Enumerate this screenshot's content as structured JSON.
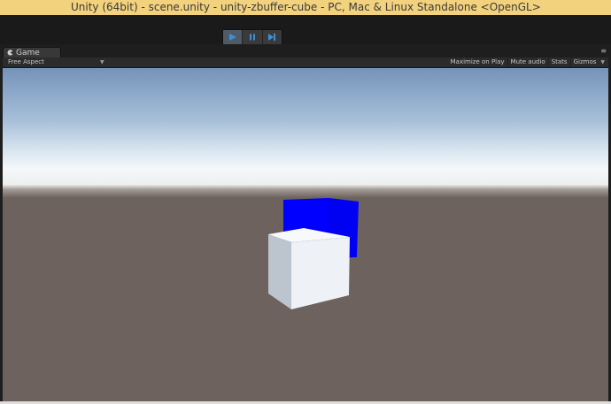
{
  "window": {
    "title": "Unity (64bit) - scene.unity - unity-zbuffer-cube - PC, Mac & Linux Standalone <OpenGL>"
  },
  "play_controls": {
    "play_icon": "play-icon",
    "pause_icon": "pause-icon",
    "step_icon": "step-icon",
    "play_active": true
  },
  "game_tab": {
    "label": "Game",
    "icon": "pacman-icon"
  },
  "game_toolbar": {
    "aspect": "Free Aspect",
    "maximize": "Maximize on Play",
    "mute": "Mute audio",
    "stats": "Stats",
    "gizmos": "Gizmos"
  },
  "scene": {
    "objects": [
      {
        "name": "blue cube",
        "color": "#0000ff"
      },
      {
        "name": "white cube",
        "color": "#eef1f6"
      }
    ]
  },
  "colors": {
    "title_bar": "#f2d27d",
    "sky_top": "#7593b9",
    "horizon": "#f4f8fb",
    "ground": "#6d625d"
  }
}
